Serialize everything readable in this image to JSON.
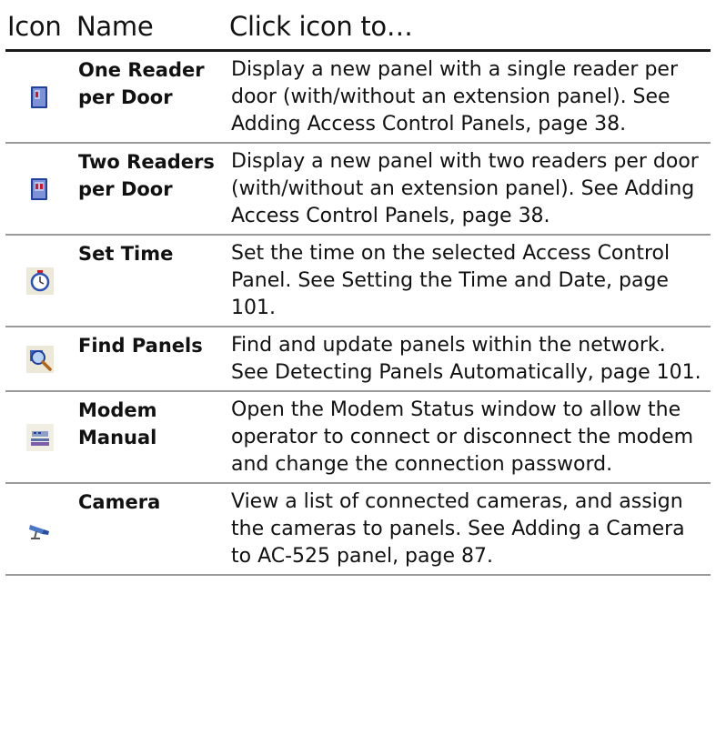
{
  "headers": {
    "icon": "Icon",
    "name": "Name",
    "action": "Click icon to…"
  },
  "rows": [
    {
      "icon": "single-reader-panel-icon",
      "name": "One Reader per Door",
      "description": "Display a new panel with a single reader per door (with/without an extension panel). See Adding Access Control Panels, page 38."
    },
    {
      "icon": "two-reader-panel-icon",
      "name": "Two Readers per Door",
      "description": "Display a new panel with two readers per door (with/without an extension panel). See Adding Access Control Panels, page 38."
    },
    {
      "icon": "stopwatch-icon",
      "name": "Set Time",
      "description": "Set the time on the selected Access Control Panel. See Setting the Time and Date, page 101."
    },
    {
      "icon": "magnifier-icon",
      "name": "Find Panels",
      "description": "Find and update panels within the network. See Detecting Panels Automatically, page 101."
    },
    {
      "icon": "modem-icon",
      "name": "Modem Manual",
      "description": "Open the Modem Status window to allow the operator to connect or disconnect the modem and change the connection password."
    },
    {
      "icon": "camera-icon",
      "name": "Camera",
      "description": "View a list of connected cameras, and assign the cameras to panels. See Adding a Camera to AC-525 panel, page 87."
    }
  ]
}
